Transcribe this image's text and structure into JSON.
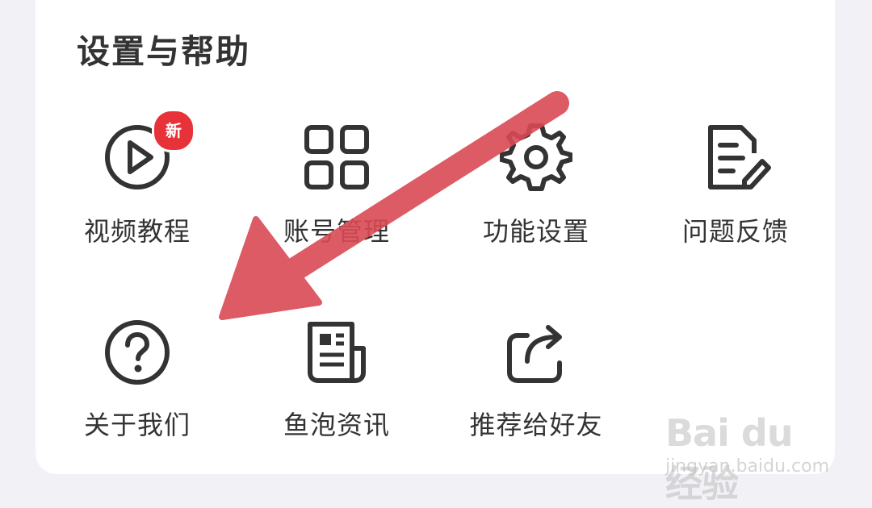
{
  "section": {
    "title": "设置与帮助"
  },
  "items": [
    {
      "id": "video-tutorial",
      "label": "视频教程",
      "icon": "play-circle-icon",
      "badge": "新"
    },
    {
      "id": "account-management",
      "label": "账号管理",
      "icon": "grid-squares-icon"
    },
    {
      "id": "function-settings",
      "label": "功能设置",
      "icon": "gear-icon"
    },
    {
      "id": "feedback",
      "label": "问题反馈",
      "icon": "document-edit-icon"
    },
    {
      "id": "about-us",
      "label": "关于我们",
      "icon": "question-circle-icon"
    },
    {
      "id": "yupao-news",
      "label": "鱼泡资讯",
      "icon": "newspaper-icon"
    },
    {
      "id": "recommend-friends",
      "label": "推荐给好友",
      "icon": "share-icon"
    }
  ],
  "overlay": {
    "annotation": "red-arrow-pointing-to-about-us"
  },
  "watermark": {
    "brand": "Bai du 经验",
    "url": "jingyan.baidu.com"
  },
  "colors": {
    "badge": "#e8323a",
    "arrow": "#d94a55",
    "icon": "#333333",
    "text": "#333333"
  }
}
